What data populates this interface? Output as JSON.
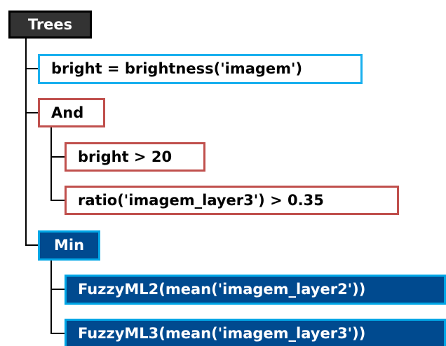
{
  "tree": {
    "root": {
      "label": "Trees"
    },
    "assignment": {
      "label": "bright = brightness('imagem')"
    },
    "and_node": {
      "label": "And",
      "conditions": [
        {
          "label": "bright > 20"
        },
        {
          "label": "ratio('imagem_layer3') > 0.35"
        }
      ]
    },
    "min_node": {
      "label": "Min",
      "members": [
        {
          "label": "FuzzyML2(mean('imagem_layer2'))"
        },
        {
          "label": "FuzzyML3(mean('imagem_layer3'))"
        }
      ]
    }
  },
  "colors": {
    "root_fill": "#333333",
    "assignment_border": "#1ab0ee",
    "logic_border": "#c0504d",
    "fuzzy_fill": "#004a8f",
    "fuzzy_border": "#00a6e6",
    "connector": "#000000"
  }
}
